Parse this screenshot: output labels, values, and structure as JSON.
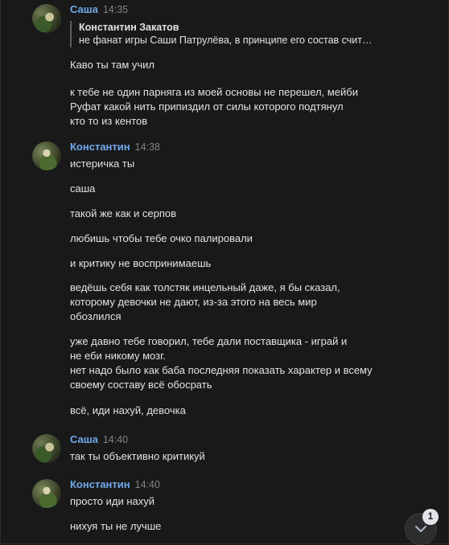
{
  "messages": [
    {
      "author": "Саша",
      "time": "14:35",
      "reply": {
        "author": "Константин Закатов",
        "text": "не фанат игры Саши Патрулёва, в принципе его состав счит…"
      },
      "lines": [
        "Каво ты там учил",
        "к тебе не один парняга из моей основы не перешел, мейби",
        "Руфат какой нить припиздил от силы которого подтянул",
        "кто то из кентов"
      ]
    },
    {
      "author": "Константин",
      "time": "14:38",
      "lines": [
        "истеричка ты",
        "саша",
        "такой же как и серпов",
        "любишь чтобы тебе очко палировали",
        "и критику не воспринимаешь",
        "ведёшь себя как толстяк инцельный даже, я бы сказал,",
        "которому девочки не дают, из-за этого на весь мир",
        "обозлился",
        "уже давно тебе говорил, тебе дали поставщика - играй и",
        "не еби никому мозг.",
        "нет надо было как баба последняя показать характер и всему",
        "своему составу всё обосрать",
        "всё, иди нахуй, девочка"
      ]
    },
    {
      "author": "Саша",
      "time": "14:40",
      "lines": [
        "так ты объективно критикуй"
      ]
    },
    {
      "author": "Константин",
      "time": "14:40",
      "lines": [
        "просто иди нахуй",
        "нихуя ты не лучше"
      ]
    }
  ],
  "unread_badge": "1",
  "scroll_down_icon": "chevron-down-icon",
  "colors": {
    "background": "#19191a",
    "author": "#71aaeb",
    "text": "#e1e3e6",
    "time": "#828282"
  }
}
